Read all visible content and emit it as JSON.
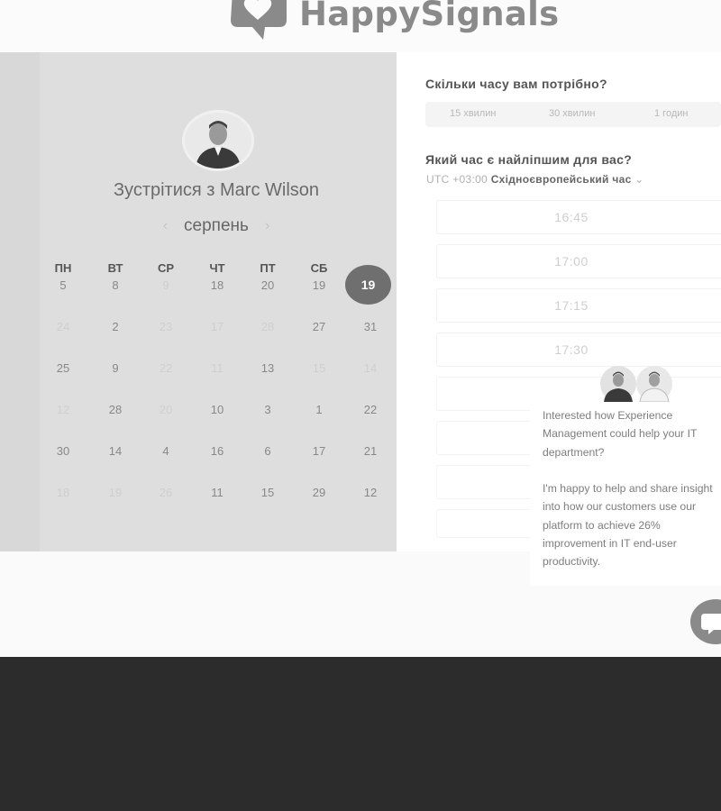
{
  "header": {
    "brand": "HappySignals",
    "logo_icon": "chat-heart-logo-icon"
  },
  "calendar": {
    "title": "Зустрітися з Marc Wilson",
    "month": "серпень",
    "prev_icon": "chevron-left-icon",
    "next_icon": "chevron-right-icon",
    "weekdays": [
      "ПН",
      "ВТ",
      "СР",
      "ЧТ",
      "ПТ",
      "СБ"
    ],
    "selected_day": "19",
    "rows": [
      [
        "5",
        "8",
        "9",
        "18",
        "20",
        "19"
      ],
      [
        "24",
        "2",
        "23",
        "17",
        "28",
        "27",
        "31"
      ],
      [
        "25",
        "9",
        "22",
        "11",
        "13",
        "15",
        "14"
      ],
      [
        "12",
        "28",
        "20",
        "10",
        "3",
        "1",
        "22"
      ],
      [
        "30",
        "14",
        "4",
        "16",
        "6",
        "17",
        "21"
      ],
      [
        "18",
        "19",
        "26",
        "11",
        "15",
        "29",
        "12"
      ]
    ]
  },
  "booking": {
    "duration_question": "Скільки часу вам потрібно?",
    "durations": [
      "15 хвилин",
      "30 хвилин",
      "1 годин"
    ],
    "time_question": "Який час є найліпшим для вас?",
    "timezone_offset": "UTC +03:00",
    "timezone_name": "Східноєвропейський час",
    "timezone_caret_icon": "caret-down-icon",
    "slots": [
      "16:45",
      "17:00",
      "17:15",
      "17:30"
    ]
  },
  "chat_popup": {
    "message": "Interested how Experience Management could help your IT department?\n\nI'm happy to help and share insight into how our customers use our platform to achieve 26% improvement in IT end-user productivity."
  },
  "colors": {
    "left_panel": "#dedede",
    "selected_day": "#6f6f6f",
    "footer": "#2c2c2c"
  }
}
